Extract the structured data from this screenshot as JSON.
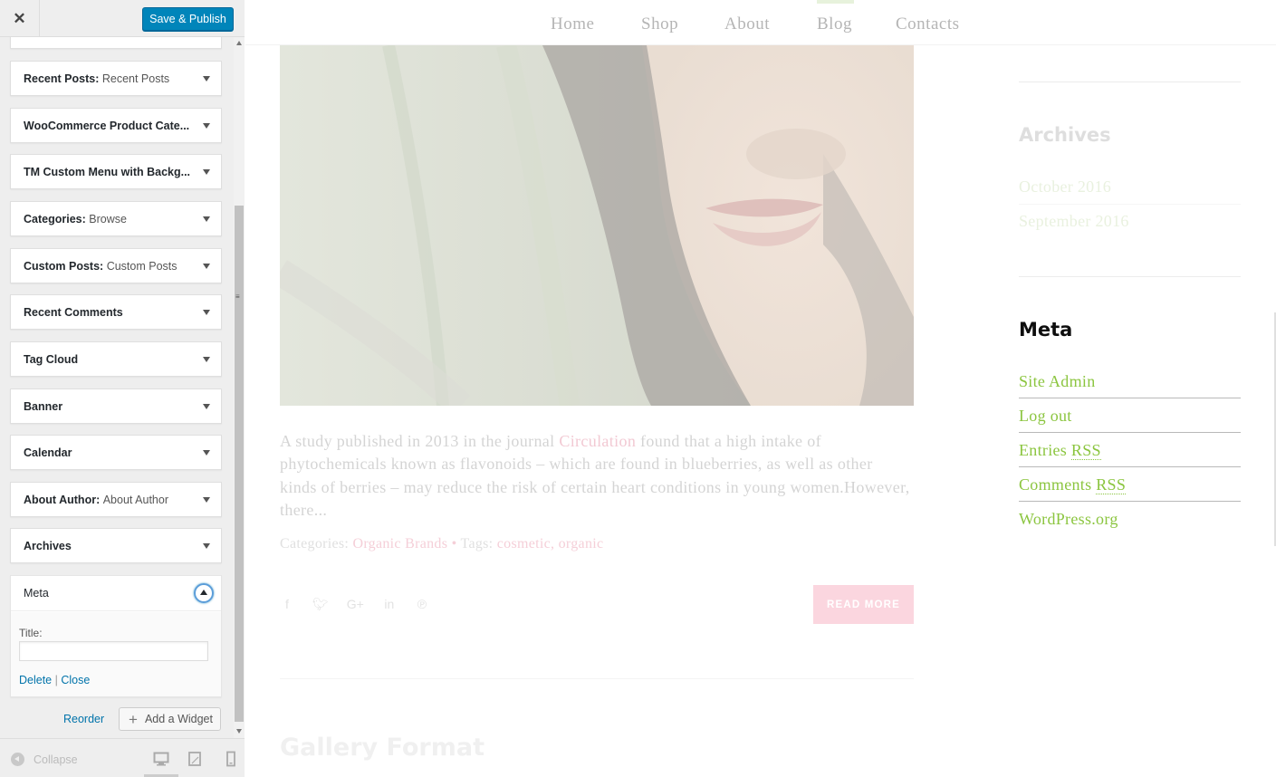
{
  "customizer": {
    "close_icon": "close-icon",
    "publish_label": "Save & Publish",
    "widgets": [
      {
        "title": "Recent Posts",
        "subtitle": "Recent Posts"
      },
      {
        "title": "WooCommerce Product Cate...",
        "subtitle": ""
      },
      {
        "title": "TM Custom Menu with Backg...",
        "subtitle": ""
      },
      {
        "title": "Categories",
        "subtitle": "Browse"
      },
      {
        "title": "Custom Posts",
        "subtitle": "Custom Posts"
      },
      {
        "title": "Recent Comments",
        "subtitle": ""
      },
      {
        "title": "Tag Cloud",
        "subtitle": ""
      },
      {
        "title": "Banner",
        "subtitle": ""
      },
      {
        "title": "Calendar",
        "subtitle": ""
      },
      {
        "title": "About Author",
        "subtitle": "About Author"
      },
      {
        "title": "Archives",
        "subtitle": ""
      }
    ],
    "meta_widget": {
      "title": "Meta",
      "field_label": "Title:",
      "field_value": "",
      "delete_label": "Delete",
      "separator": "|",
      "close_label": "Close"
    },
    "reorder_label": "Reorder",
    "add_widget_label": "Add a Widget",
    "collapse_label": "Collapse",
    "devices": [
      "desktop-icon",
      "tablet-icon",
      "mobile-icon"
    ]
  },
  "preview": {
    "nav": [
      "Home",
      "Shop",
      "About",
      "Blog",
      "Contacts"
    ],
    "active_nav": "Blog",
    "excerpt_before": "A study published in 2013 in the journal ",
    "excerpt_highlight": "Circulation",
    "excerpt_after": " found that a high intake of phytochemicals known as flavonoids – which are found in blueberries, as well as other kinds of berries – may reduce the risk of certain heart conditions in young women.However, there...",
    "categories_label": "Categories:",
    "category": "Organic Brands",
    "meta_separator": "•",
    "tags_label": "Tags:",
    "tags": "cosmetic, organic",
    "share_icons": [
      "facebook-icon",
      "twitter-icon",
      "google-plus-icon",
      "linkedin-icon",
      "pinterest-icon"
    ],
    "read_more": "READ MORE",
    "next_post_title": "Gallery Format",
    "sidebar": {
      "archives_title": "Archives",
      "archives": [
        "October 2016",
        "September 2016"
      ],
      "meta_title": "Meta",
      "meta_links": [
        {
          "text": "Site Admin",
          "abbr": ""
        },
        {
          "text": "Log out",
          "abbr": ""
        },
        {
          "text": "Entries ",
          "abbr": "RSS"
        },
        {
          "text": "Comments ",
          "abbr": "RSS"
        },
        {
          "text": "WordPress.org",
          "abbr": ""
        }
      ]
    }
  },
  "colors": {
    "publish_button": "#0085ba",
    "link_blue": "#0073aa",
    "meta_link_green": "#8bc53f",
    "read_more_pink": "#fbd6df"
  }
}
